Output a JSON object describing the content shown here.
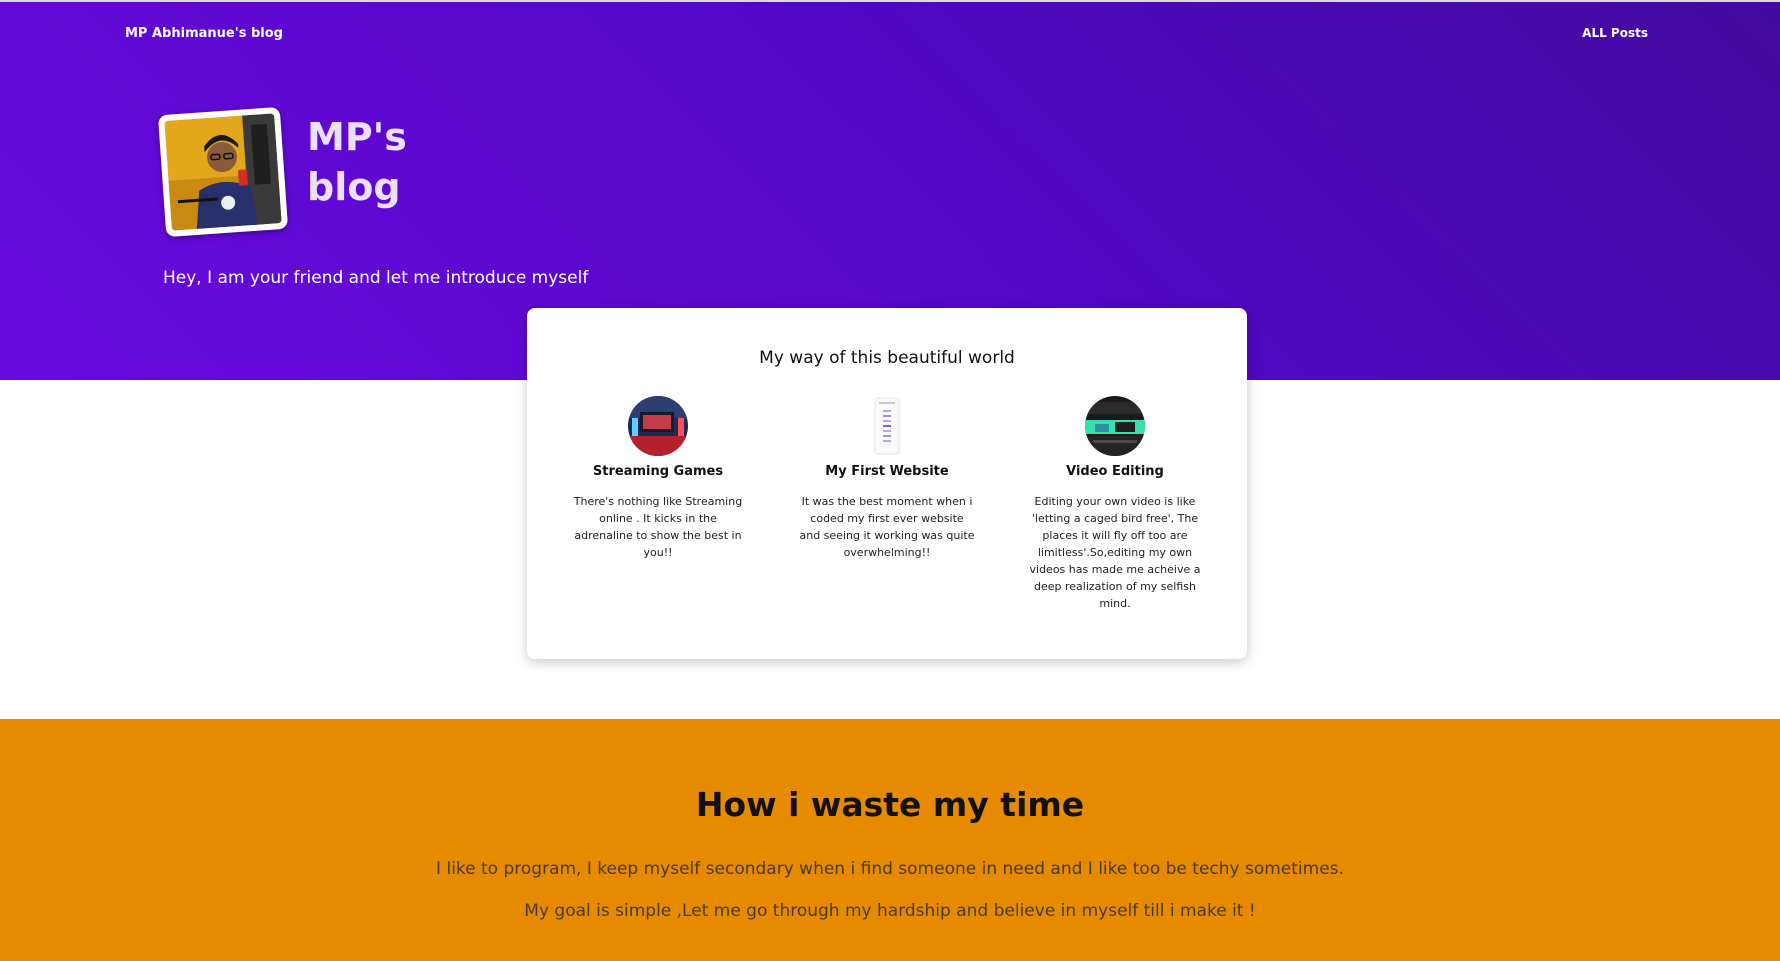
{
  "nav": {
    "brand": "MP Abhimanue's blog",
    "all_posts": "ALL Posts"
  },
  "hero": {
    "title": "MP's blog",
    "tagline": "Hey, I am your friend and let me introduce myself"
  },
  "card": {
    "title": "My way of this beautiful world",
    "features": [
      {
        "title": "Streaming Games",
        "description": "There's nothing like Streaming online . It kicks in the adrenaline to show the best in you!!",
        "icon": "gaming-setup-image"
      },
      {
        "title": "My First Website",
        "description": "It was the best moment when i coded my first ever website and seeing it working was quite overwhelming!!",
        "icon": "website-screenshot-image"
      },
      {
        "title": "Video Editing",
        "description": "Editing your own video is like 'letting a caged bird free', The places it will fly off too are limitless'.So,editing my own videos has made me acheive a deep realization of my selfish mind.",
        "icon": "video-editing-image"
      }
    ]
  },
  "about": {
    "title": "How i waste my time",
    "line1": "I like to program, I keep myself secondary when i find someone in need and I like too be techy sometimes.",
    "line2": "My goal is simple ,Let me go through my hardship and believe in myself till i make it !"
  },
  "colors": {
    "hero_gradient_start": "#6a0ae0",
    "hero_gradient_end": "#420ba0",
    "about_background": "#e68a00",
    "card_background": "#ffffff"
  }
}
